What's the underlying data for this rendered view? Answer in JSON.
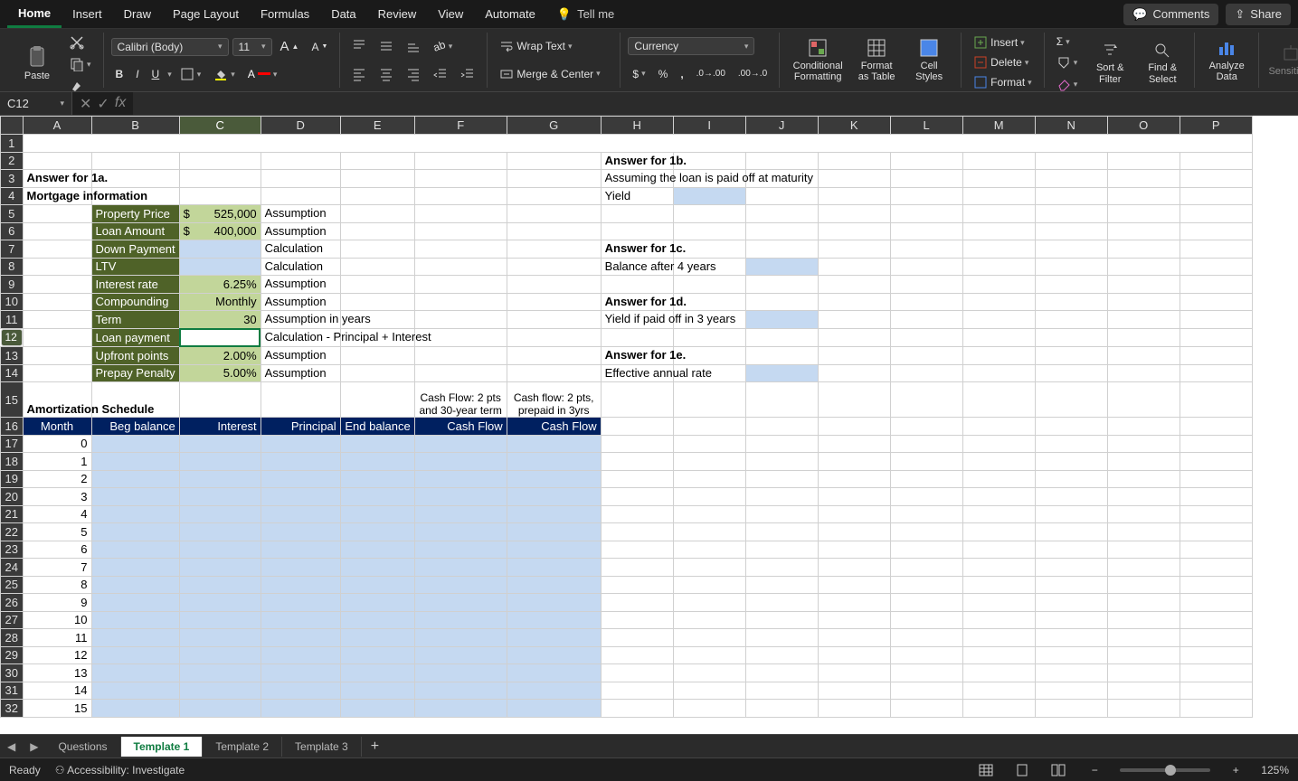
{
  "ribbonTabs": [
    "Home",
    "Insert",
    "Draw",
    "Page Layout",
    "Formulas",
    "Data",
    "Review",
    "View",
    "Automate"
  ],
  "activeRibbonTab": "Home",
  "tellMe": "Tell me",
  "comments": "Comments",
  "share": "Share",
  "clipboard": {
    "paste": "Paste"
  },
  "font": {
    "name": "Calibri (Body)",
    "size": "11",
    "bold": "B",
    "italic": "I",
    "underline": "U"
  },
  "align": {
    "wrap": "Wrap Text",
    "merge": "Merge & Center"
  },
  "numberFormat": {
    "name": "Currency"
  },
  "styleBtns": {
    "cond": "Conditional Formatting",
    "table": "Format as Table",
    "cell": "Cell Styles"
  },
  "cells": {
    "insert": "Insert",
    "delete": "Delete",
    "format": "Format"
  },
  "editing": {
    "sort": "Sort & Filter",
    "find": "Find & Select"
  },
  "analyze": "Analyze Data",
  "sensitivity": "Sensitivity",
  "nameBox": "C12",
  "formula": "",
  "columns": [
    "A",
    "B",
    "C",
    "D",
    "E",
    "F",
    "G",
    "H",
    "I",
    "J",
    "K",
    "L",
    "M",
    "N",
    "O",
    "P"
  ],
  "rows": {
    "2": {
      "H": "Answer for 1b."
    },
    "3": {
      "A": "Answer for 1a.",
      "H": "Assuming the loan is paid off at maturity"
    },
    "4": {
      "A": "Mortgage information",
      "H": "Yield"
    },
    "5": {
      "B": "Property Price",
      "C_sym": "$",
      "C": "525,000",
      "D": "Assumption"
    },
    "6": {
      "B": "Loan Amount",
      "C_sym": "$",
      "C": "400,000",
      "D": "Assumption"
    },
    "7": {
      "B": "Down Payment",
      "D": "Calculation",
      "H": "Answer for 1c."
    },
    "8": {
      "B": "LTV",
      "D": "Calculation",
      "H": "Balance after 4 years"
    },
    "9": {
      "B": "Interest rate",
      "C": "6.25%",
      "D": "Assumption"
    },
    "10": {
      "B": "Compounding",
      "C": "Monthly",
      "D": "Assumption",
      "H": "Answer for 1d."
    },
    "11": {
      "B": "Term",
      "C": "30",
      "D": "Assumption in years",
      "H": "Yield if paid off in 3 years"
    },
    "12": {
      "B": "Loan payment",
      "D": "Calculation - Principal + Interest"
    },
    "13": {
      "B": "Upfront points",
      "C": "2.00%",
      "D": "Assumption",
      "H": "Answer for 1e."
    },
    "14": {
      "B": "Prepay Penalty",
      "C": "5.00%",
      "D": "Assumption",
      "H": "Effective annual rate"
    },
    "15": {
      "A": "Amortization Schedule",
      "F": "Cash Flow: 2 pts and 30-year term",
      "G": "Cash flow: 2 pts, prepaid in 3yrs"
    },
    "16": {
      "A": "Month",
      "B": "Beg balance",
      "C": "Interest",
      "D": "Principal",
      "E": "End balance",
      "F": "Cash Flow",
      "G": "Cash Flow"
    }
  },
  "amortMonths": [
    "0",
    "1",
    "2",
    "3",
    "4",
    "5",
    "6",
    "7",
    "8",
    "9",
    "10",
    "11",
    "12",
    "13",
    "14",
    "15"
  ],
  "sheetTabs": [
    "Questions",
    "Template 1",
    "Template 2",
    "Template 3"
  ],
  "activeSheetTab": "Template 1",
  "status": {
    "ready": "Ready",
    "acc": "Accessibility: Investigate",
    "zoom": "125%"
  }
}
